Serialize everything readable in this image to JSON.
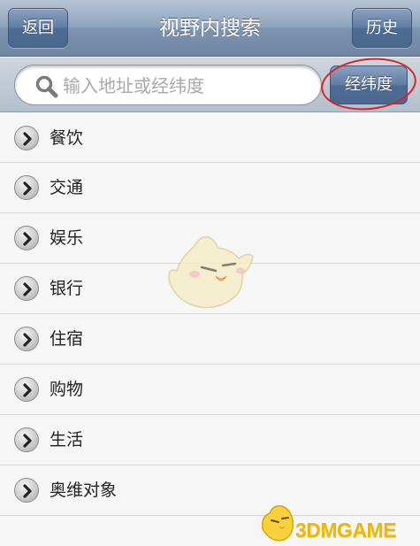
{
  "nav": {
    "back_label": "返回",
    "title": "视野内搜索",
    "history_label": "历史"
  },
  "search": {
    "placeholder": "输入地址或经纬度",
    "value": "",
    "coord_button_label": "经纬度"
  },
  "categories": [
    {
      "label": "餐饮"
    },
    {
      "label": "交通"
    },
    {
      "label": "娱乐"
    },
    {
      "label": "银行"
    },
    {
      "label": "住宿"
    },
    {
      "label": "购物"
    },
    {
      "label": "生活"
    },
    {
      "label": "奥维对象"
    }
  ],
  "watermark": {
    "brand": "3DMGAME"
  },
  "icons": {
    "search": "search-icon",
    "row_chevron": "chevron-right-icon"
  },
  "colors": {
    "nav_blue": "#5f7ca2",
    "highlight_red": "#d8232a",
    "brand_yellow": "#f2b700"
  }
}
